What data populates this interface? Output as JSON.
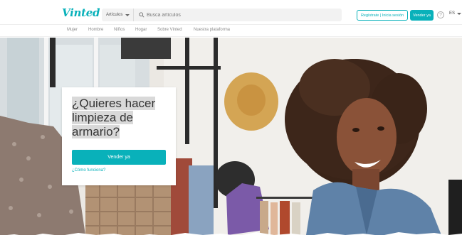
{
  "header": {
    "logo": "Vinted",
    "category_select": "Artículos",
    "search_placeholder": "Busca artículos",
    "register_label": "Regístrate | Inicia sesión",
    "sell_label": "Vender ya",
    "help_icon": "?",
    "language": "ES"
  },
  "nav": {
    "items": [
      "Mujer",
      "Hombre",
      "Niños",
      "Hogar",
      "Sobre Vinted",
      "Nuestra plataforma"
    ]
  },
  "hero": {
    "title": "¿Quieres hacer limpieza de armario?",
    "sell_button": "Vender ya",
    "how_link": "¿Cómo funciona?"
  },
  "icons": {
    "search": "search-icon",
    "help": "help-icon",
    "caret": "chevron-down-icon"
  },
  "colors": {
    "brand": "#09b1ba",
    "text": "#333333",
    "nav_text": "#8a8a8a"
  }
}
